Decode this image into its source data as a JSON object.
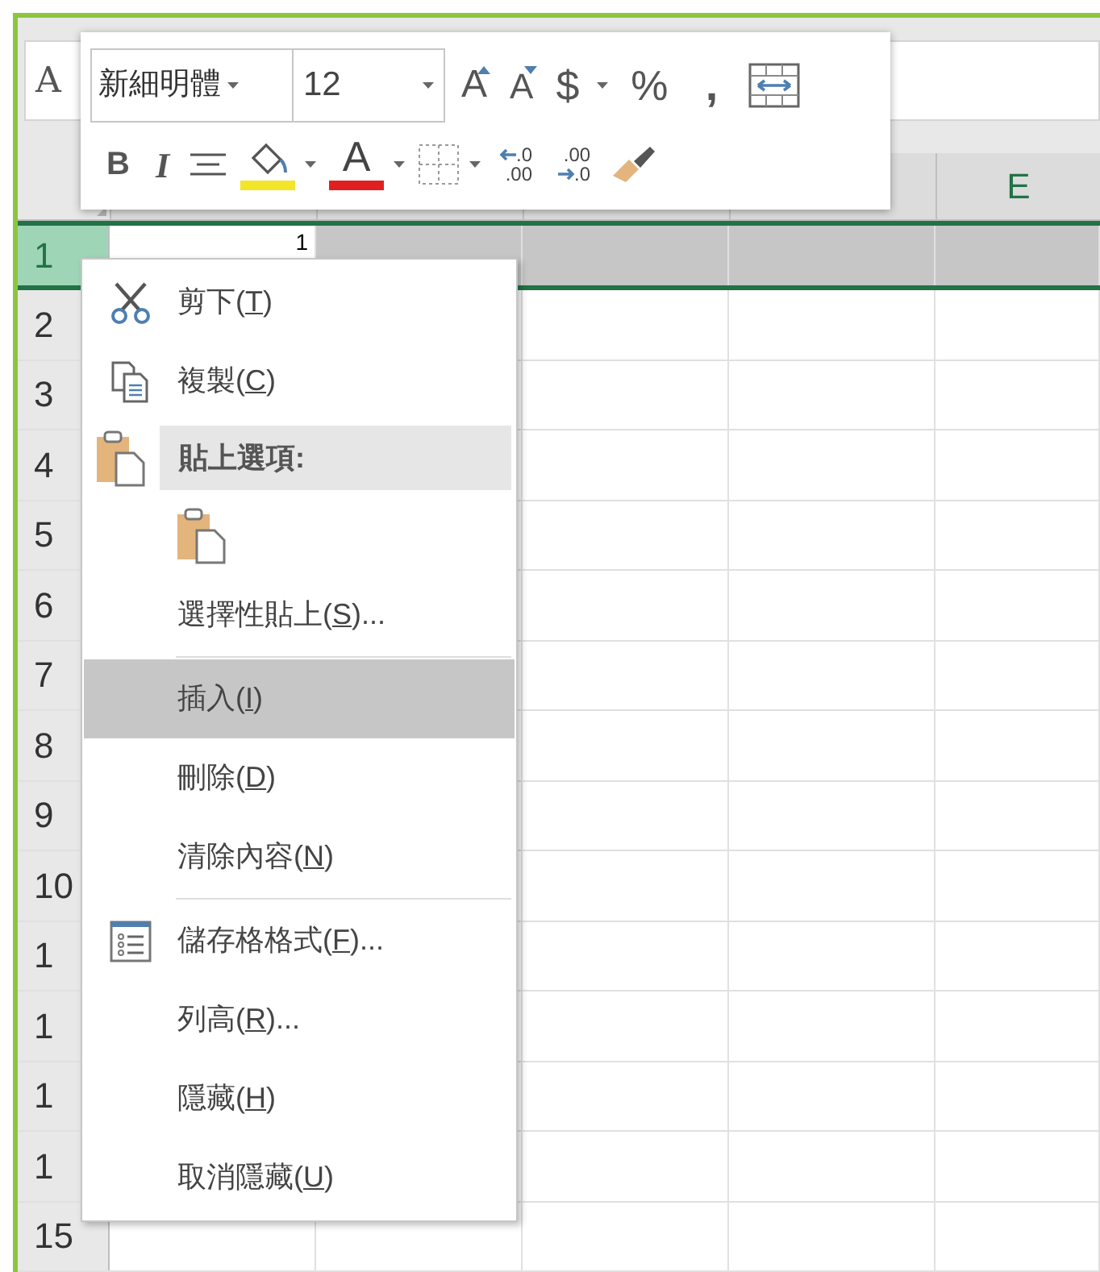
{
  "name_box": "A",
  "toolbar": {
    "font_name": "新細明體",
    "font_size": "12",
    "grow_font": "A",
    "shrink_font": "A",
    "currency": "$",
    "percent": "%",
    "comma": ",",
    "bold": "B",
    "italic": "I",
    "font_color_label": "A",
    "increase_decimal": [
      ".0",
      ".00"
    ],
    "decrease_decimal": [
      ".00",
      ".0"
    ]
  },
  "column_headers": [
    "E"
  ],
  "rows": [
    {
      "number": "1",
      "selected": true,
      "cell_a": "1"
    },
    {
      "number": "2",
      "selected": false
    },
    {
      "number": "3",
      "selected": false
    },
    {
      "number": "4",
      "selected": false
    },
    {
      "number": "5",
      "selected": false
    },
    {
      "number": "6",
      "selected": false
    },
    {
      "number": "7",
      "selected": false
    },
    {
      "number": "8",
      "selected": false
    },
    {
      "number": "9",
      "selected": false
    },
    {
      "number": "10",
      "selected": false
    },
    {
      "number": "1",
      "selected": false
    },
    {
      "number": "1",
      "selected": false
    },
    {
      "number": "1",
      "selected": false
    },
    {
      "number": "1",
      "selected": false
    },
    {
      "number": "15",
      "selected": false
    }
  ],
  "context_menu": [
    {
      "kind": "item",
      "before": "剪下(",
      "key": "T",
      "after": ")",
      "selected": false
    },
    {
      "kind": "item",
      "before": "複製(",
      "key": "C",
      "after": ")",
      "selected": false
    },
    {
      "kind": "header",
      "label": "貼上選項:"
    },
    {
      "kind": "paste"
    },
    {
      "kind": "item",
      "before": "選擇性貼上(",
      "key": "S",
      "after": ")...",
      "selected": false
    },
    {
      "kind": "separator"
    },
    {
      "kind": "item",
      "before": "插入(",
      "key": "I",
      "after": ")",
      "selected": true
    },
    {
      "kind": "item",
      "before": "刪除(",
      "key": "D",
      "after": ")",
      "selected": false
    },
    {
      "kind": "item",
      "before": "清除內容(",
      "key": "N",
      "after": ")",
      "selected": false
    },
    {
      "kind": "separator"
    },
    {
      "kind": "item",
      "before": "儲存格格式(",
      "key": "F",
      "after": ")...",
      "selected": false
    },
    {
      "kind": "item",
      "before": "列高(",
      "key": "R",
      "after": ")...",
      "selected": false
    },
    {
      "kind": "item",
      "before": "隱藏(",
      "key": "H",
      "after": ")",
      "selected": false
    },
    {
      "kind": "item",
      "before": "取消隱藏(",
      "key": "U",
      "after": ")",
      "selected": false
    }
  ]
}
